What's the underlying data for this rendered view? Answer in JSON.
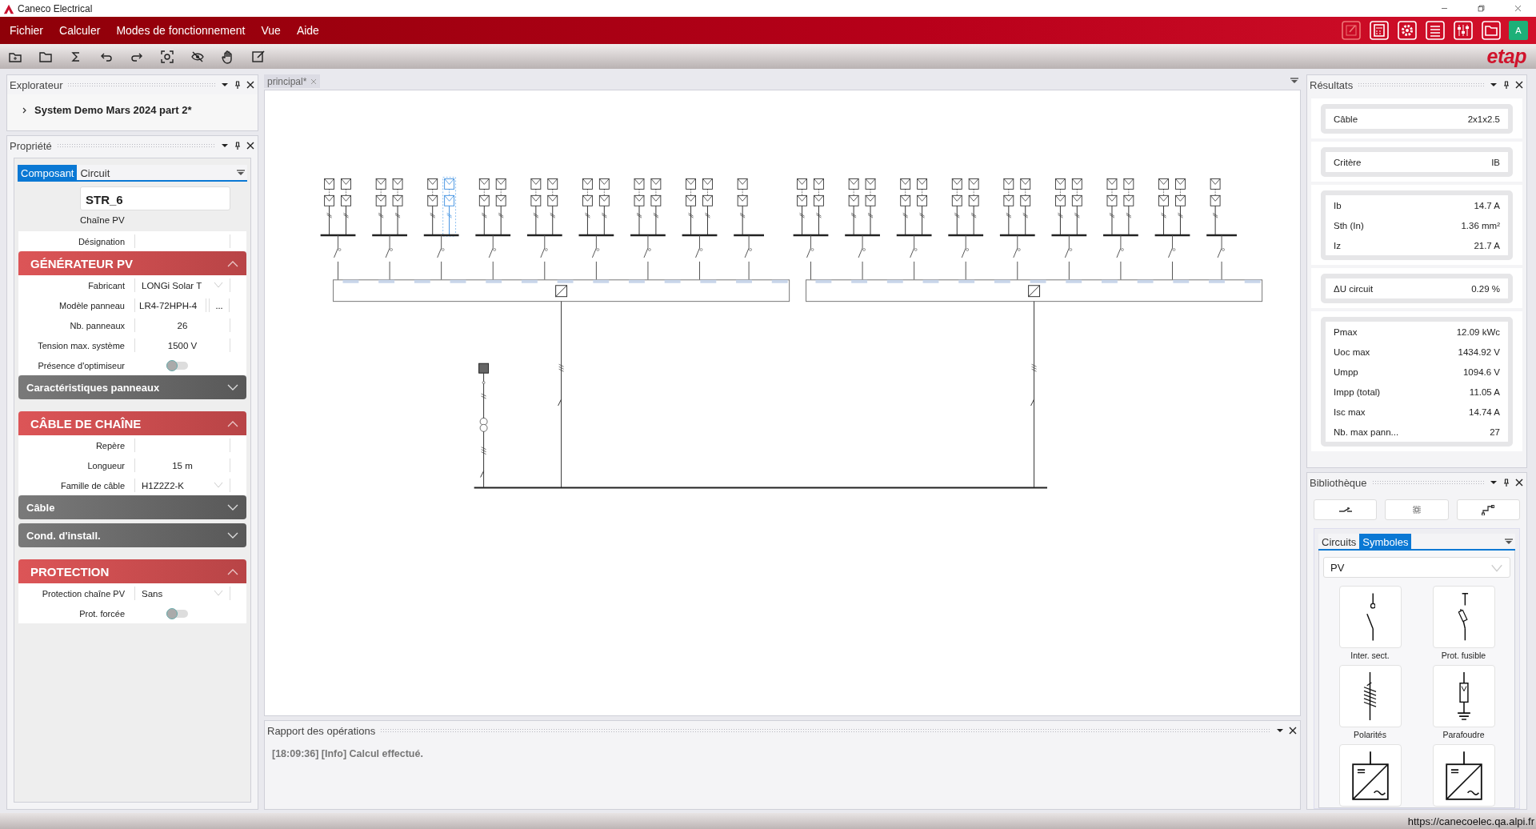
{
  "window": {
    "title": "Caneco Electrical"
  },
  "menu": [
    "Fichier",
    "Calculer",
    "Modes de fonctionnement",
    "Vue",
    "Aide"
  ],
  "user": {
    "initial": "A"
  },
  "logo": "etap",
  "explorer": {
    "title": "Explorateur",
    "items": [
      {
        "label": "System Demo Mars 2024 part 2*",
        "expanded": false
      }
    ]
  },
  "properties": {
    "title": "Propriété",
    "tabs": [
      {
        "label": "Composant",
        "selected": true
      },
      {
        "label": "Circuit",
        "selected": false
      }
    ],
    "name": "STR_6",
    "type": "Chaîne PV",
    "rows": [
      {
        "label": "Désignation",
        "kind": "text"
      }
    ],
    "sections": [
      {
        "title": "GÉNÉRATEUR PV",
        "expanded": true,
        "rows": [
          {
            "label": "Fabricant",
            "kind": "dropdown",
            "value": "LONGi Solar T"
          },
          {
            "label": "Modèle panneau",
            "kind": "browse",
            "value": "LR4-72HPH-4",
            "button": "..."
          },
          {
            "label": "Nb. panneaux",
            "kind": "text",
            "value": "26"
          },
          {
            "label": "Tension max. système",
            "kind": "text",
            "value": "1500 V"
          },
          {
            "label": "Présence d'optimiseur",
            "kind": "toggle",
            "on": false
          }
        ]
      },
      {
        "title": "Caractéristiques panneaux",
        "expanded": false
      },
      {
        "title": "CÂBLE DE CHAÎNE",
        "expanded": true,
        "rows": [
          {
            "label": "Repère",
            "kind": "text"
          },
          {
            "label": "Longueur",
            "kind": "text",
            "value": "15 m"
          },
          {
            "label": "Famille de câble",
            "kind": "dropdown",
            "value": "H1Z2Z2-K"
          }
        ]
      },
      {
        "title": "Câble",
        "expanded": false
      },
      {
        "title": "Cond. d'install.",
        "expanded": false
      },
      {
        "title": "PROTECTION",
        "expanded": true,
        "rows": [
          {
            "label": "Protection chaîne PV",
            "kind": "dropdown",
            "value": "Sans"
          },
          {
            "label": "Prot. forcée",
            "kind": "toggle",
            "on": false
          }
        ]
      }
    ]
  },
  "document": {
    "tab": "principal*",
    "diagram": {
      "inverters": [
        {
          "groups": [
            {
              "strings": [
                {
                  "selected": false
                },
                {
                  "selected": false
                }
              ]
            },
            {
              "strings": [
                {
                  "selected": false
                },
                {
                  "selected": false
                }
              ]
            },
            {
              "strings": [
                {
                  "selected": false
                },
                {
                  "selected": true
                }
              ]
            },
            {
              "strings": [
                {
                  "selected": false
                },
                {
                  "selected": false
                }
              ]
            },
            {
              "strings": [
                {
                  "selected": false
                },
                {
                  "selected": false
                }
              ]
            },
            {
              "strings": [
                {
                  "selected": false
                },
                {
                  "selected": false
                }
              ]
            },
            {
              "strings": [
                {
                  "selected": false
                },
                {
                  "selected": false
                }
              ]
            },
            {
              "strings": [
                {
                  "selected": false
                },
                {
                  "selected": false
                }
              ]
            },
            {
              "strings": [
                {
                  "selected": false
                }
              ]
            }
          ]
        },
        {
          "groups": [
            {
              "strings": [
                {
                  "selected": false
                },
                {
                  "selected": false
                }
              ]
            },
            {
              "strings": [
                {
                  "selected": false
                },
                {
                  "selected": false
                }
              ]
            },
            {
              "strings": [
                {
                  "selected": false
                },
                {
                  "selected": false
                }
              ]
            },
            {
              "strings": [
                {
                  "selected": false
                },
                {
                  "selected": false
                }
              ]
            },
            {
              "strings": [
                {
                  "selected": false
                },
                {
                  "selected": false
                }
              ]
            },
            {
              "strings": [
                {
                  "selected": false
                },
                {
                  "selected": false
                }
              ]
            },
            {
              "strings": [
                {
                  "selected": false
                },
                {
                  "selected": false
                }
              ]
            },
            {
              "strings": [
                {
                  "selected": false
                },
                {
                  "selected": false
                }
              ]
            },
            {
              "strings": [
                {
                  "selected": false
                }
              ]
            }
          ]
        }
      ]
    }
  },
  "report": {
    "title": "Rapport des opérations",
    "messages": [
      "[18:09:36] [Info] Calcul effectué."
    ]
  },
  "results": {
    "title": "Résultats",
    "groups": [
      {
        "rows": [
          {
            "label": "Câble",
            "value": "2x1x2.5"
          }
        ]
      },
      {
        "rows": [
          {
            "label": "Critère",
            "value": "IB"
          }
        ]
      },
      {
        "rows": [
          {
            "label": "Ib",
            "value": "14.7 A"
          },
          {
            "label": "Sth (In)",
            "value": "1.36 mm²"
          },
          {
            "label": "Iz",
            "value": "21.7 A"
          }
        ]
      },
      {
        "rows": [
          {
            "label": "ΔU circuit",
            "value": "0.29 %"
          }
        ]
      },
      {
        "rows": [
          {
            "label": "Pmax",
            "value": "12.09 kWc"
          },
          {
            "label": "Uoc max",
            "value": "1434.92 V"
          },
          {
            "label": "Umpp",
            "value": "1094.6 V"
          },
          {
            "label": "Impp (total)",
            "value": "11.05 A"
          },
          {
            "label": "Isc max",
            "value": "14.74 A"
          },
          {
            "label": "Nb. max pann...",
            "value": "27"
          }
        ]
      }
    ]
  },
  "library": {
    "title": "Bibliothèque",
    "tabs": [
      {
        "label": "Circuits",
        "selected": false
      },
      {
        "label": "Symboles",
        "selected": true
      }
    ],
    "category": "PV",
    "symbols": [
      {
        "kind": "switch",
        "label": "Inter. sect."
      },
      {
        "kind": "fuse",
        "label": "Prot. fusible"
      },
      {
        "kind": "polarity",
        "label": "Polarités"
      },
      {
        "kind": "surge",
        "label": "Parafoudre"
      },
      {
        "kind": "inverter"
      },
      {
        "kind": "inverter"
      }
    ]
  },
  "status_bar": {
    "url": "https://canecoelec.qa.alpi.fr"
  }
}
